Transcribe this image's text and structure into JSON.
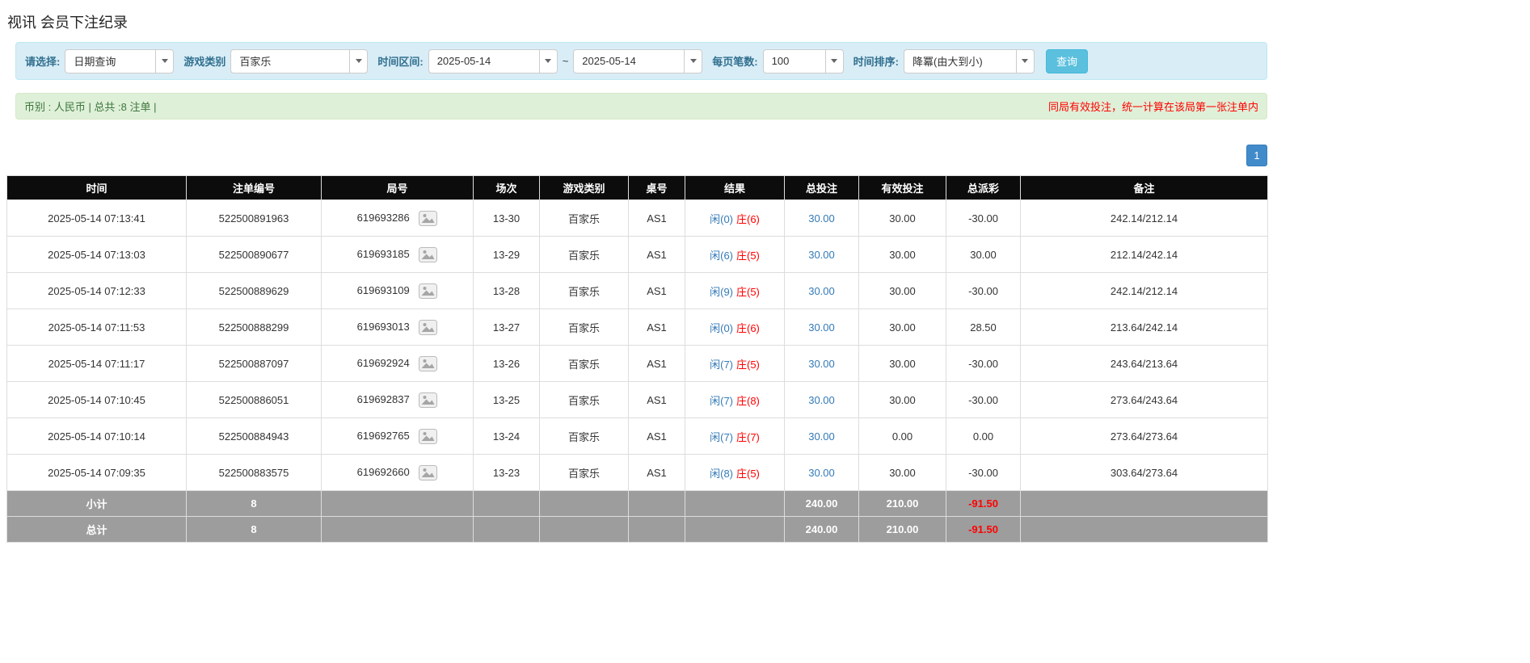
{
  "page_title": "视讯 会员下注纪录",
  "filters": {
    "select_label": "请选择:",
    "select_value": "日期查询",
    "game_label": "游戏类别",
    "game_value": "百家乐",
    "range_label": "时间区间:",
    "date_from": "2025-05-14",
    "range_separator": "~",
    "date_to": "2025-05-14",
    "page_size_label": "每页笔数:",
    "page_size_value": "100",
    "sort_label": "时间排序:",
    "sort_value": "降冪(由大到小)",
    "search_label": "查询"
  },
  "summary": {
    "currency_info": "币别 : 人民币 | 总共 :8 注单 |",
    "notice": "同局有效投注，统一计算在该局第一张注单内"
  },
  "pagination": {
    "page": "1"
  },
  "table": {
    "headers": [
      "时间",
      "注单编号",
      "局号",
      "场次",
      "游戏类别",
      "桌号",
      "结果",
      "总投注",
      "有效投注",
      "总派彩",
      "备注"
    ],
    "rows": [
      {
        "time": "2025-05-14 07:13:41",
        "bet_id": "522500891963",
        "round_id": "619693286",
        "session": "13-30",
        "game": "百家乐",
        "table_no": "AS1",
        "result_player": "闲(0)",
        "result_banker": "庄(6)",
        "total_bet": "30.00",
        "valid_bet": "30.00",
        "payout": "-30.00",
        "note": "242.14/212.14"
      },
      {
        "time": "2025-05-14 07:13:03",
        "bet_id": "522500890677",
        "round_id": "619693185",
        "session": "13-29",
        "game": "百家乐",
        "table_no": "AS1",
        "result_player": "闲(6)",
        "result_banker": "庄(5)",
        "total_bet": "30.00",
        "valid_bet": "30.00",
        "payout": "30.00",
        "note": "212.14/242.14"
      },
      {
        "time": "2025-05-14 07:12:33",
        "bet_id": "522500889629",
        "round_id": "619693109",
        "session": "13-28",
        "game": "百家乐",
        "table_no": "AS1",
        "result_player": "闲(9)",
        "result_banker": "庄(5)",
        "total_bet": "30.00",
        "valid_bet": "30.00",
        "payout": "-30.00",
        "note": "242.14/212.14"
      },
      {
        "time": "2025-05-14 07:11:53",
        "bet_id": "522500888299",
        "round_id": "619693013",
        "session": "13-27",
        "game": "百家乐",
        "table_no": "AS1",
        "result_player": "闲(0)",
        "result_banker": "庄(6)",
        "total_bet": "30.00",
        "valid_bet": "30.00",
        "payout": "28.50",
        "note": "213.64/242.14"
      },
      {
        "time": "2025-05-14 07:11:17",
        "bet_id": "522500887097",
        "round_id": "619692924",
        "session": "13-26",
        "game": "百家乐",
        "table_no": "AS1",
        "result_player": "闲(7)",
        "result_banker": "庄(5)",
        "total_bet": "30.00",
        "valid_bet": "30.00",
        "payout": "-30.00",
        "note": "243.64/213.64"
      },
      {
        "time": "2025-05-14 07:10:45",
        "bet_id": "522500886051",
        "round_id": "619692837",
        "session": "13-25",
        "game": "百家乐",
        "table_no": "AS1",
        "result_player": "闲(7)",
        "result_banker": "庄(8)",
        "total_bet": "30.00",
        "valid_bet": "30.00",
        "payout": "-30.00",
        "note": "273.64/243.64"
      },
      {
        "time": "2025-05-14 07:10:14",
        "bet_id": "522500884943",
        "round_id": "619692765",
        "session": "13-24",
        "game": "百家乐",
        "table_no": "AS1",
        "result_player": "闲(7)",
        "result_banker": "庄(7)",
        "total_bet": "30.00",
        "valid_bet": "0.00",
        "payout": "0.00",
        "note": "273.64/273.64"
      },
      {
        "time": "2025-05-14 07:09:35",
        "bet_id": "522500883575",
        "round_id": "619692660",
        "session": "13-23",
        "game": "百家乐",
        "table_no": "AS1",
        "result_player": "闲(8)",
        "result_banker": "庄(5)",
        "total_bet": "30.00",
        "valid_bet": "30.00",
        "payout": "-30.00",
        "note": "303.64/273.64"
      }
    ],
    "subtotal": {
      "label": "小计",
      "count": "8",
      "total_bet": "240.00",
      "valid_bet": "210.00",
      "payout": "-91.50"
    },
    "total": {
      "label": "总计",
      "count": "8",
      "total_bet": "240.00",
      "valid_bet": "210.00",
      "payout": "-91.50"
    }
  }
}
